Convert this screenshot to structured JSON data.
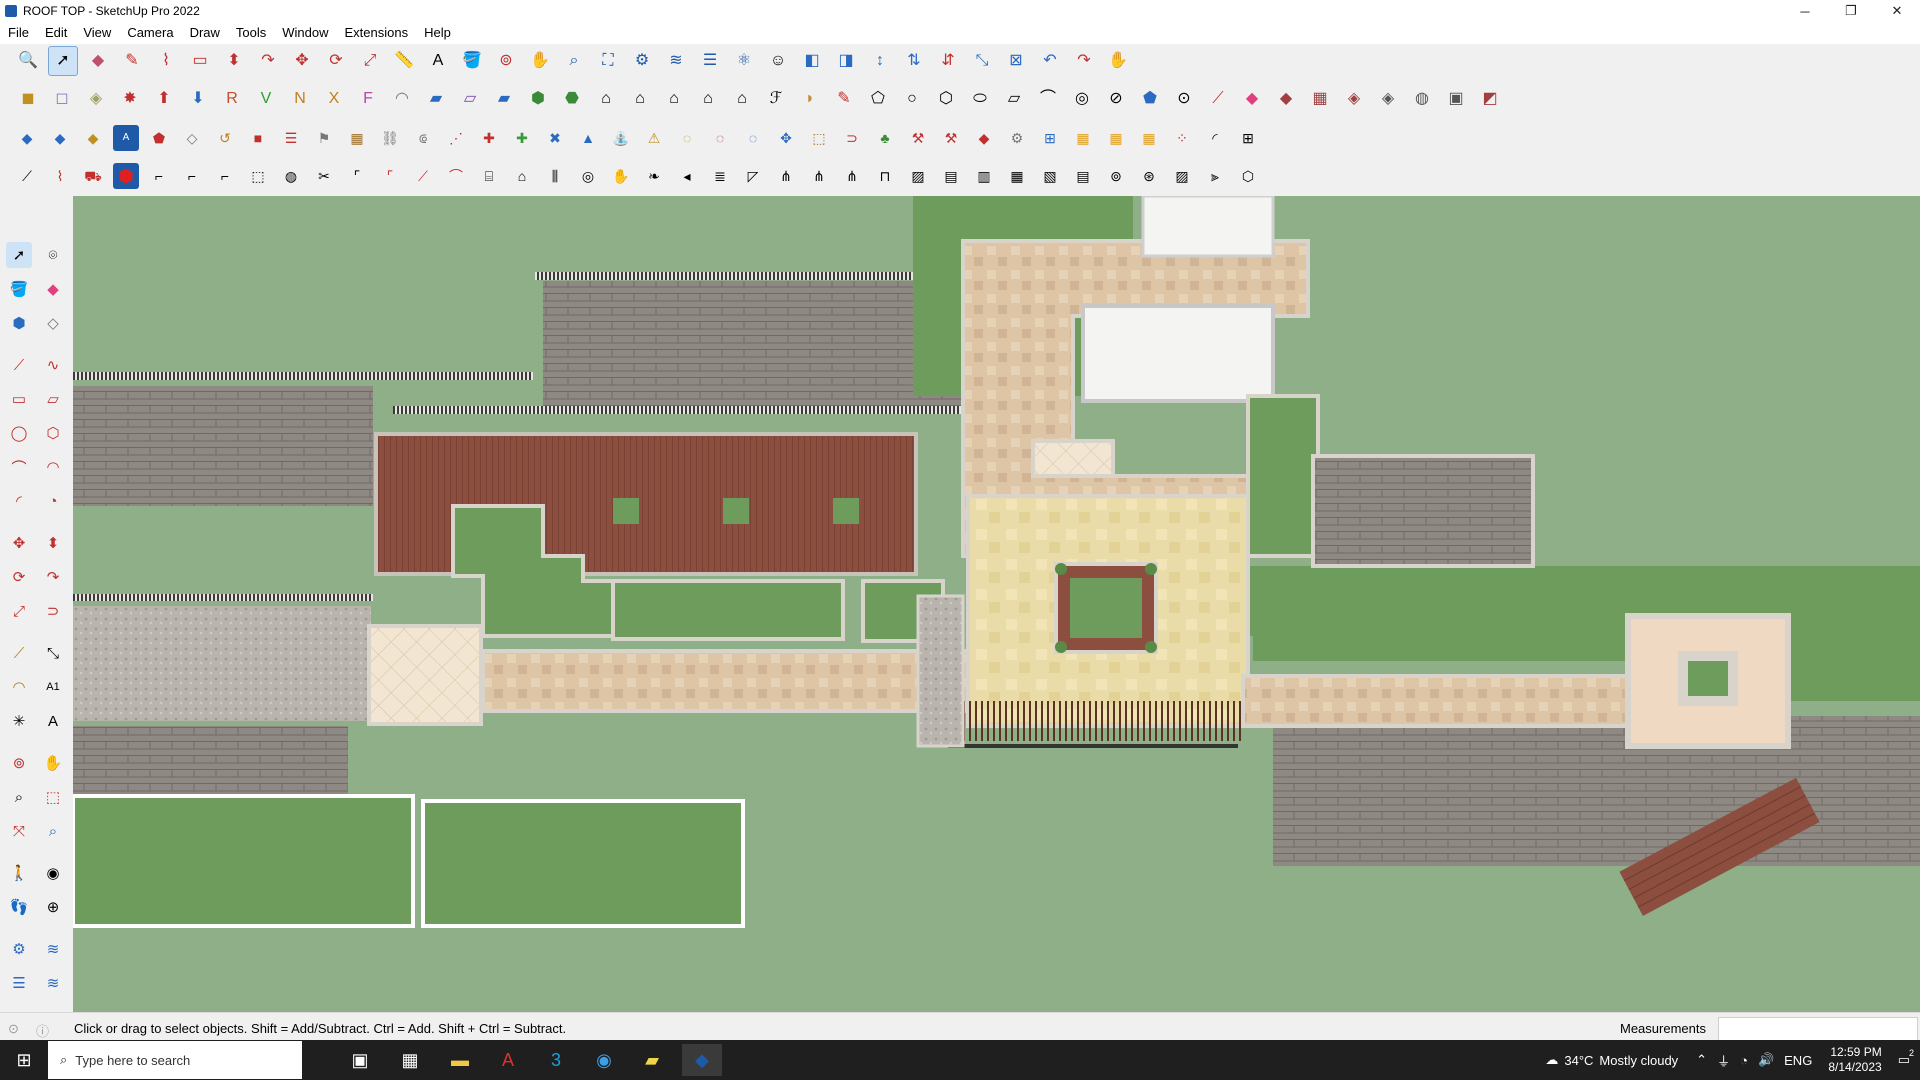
{
  "window": {
    "title": "ROOF TOP - SketchUp Pro 2022",
    "minimize": "─",
    "maximize": "❐",
    "close": "✕"
  },
  "menu": [
    "File",
    "Edit",
    "View",
    "Camera",
    "Draw",
    "Tools",
    "Window",
    "Extensions",
    "Help"
  ],
  "status": {
    "hint": "Click or drag to select objects. Shift = Add/Subtract. Ctrl = Add. Shift + Ctrl = Subtract.",
    "measurements_label": "Measurements",
    "measurements_value": ""
  },
  "taskbar": {
    "search_placeholder": "Type here to search",
    "weather_temp": "34°C",
    "weather_desc": "Mostly cloudy",
    "lang": "ENG",
    "time": "12:59 PM",
    "date": "8/14/2023",
    "notifications": "2"
  },
  "colors": {
    "grass": "#6e9c5c",
    "background_green": "#8faf88",
    "pavers": "#ddc4a4",
    "deck": "#8b4e3f",
    "roof_tiles": "#8a8580",
    "accent_blue": "#1e5aa8"
  }
}
